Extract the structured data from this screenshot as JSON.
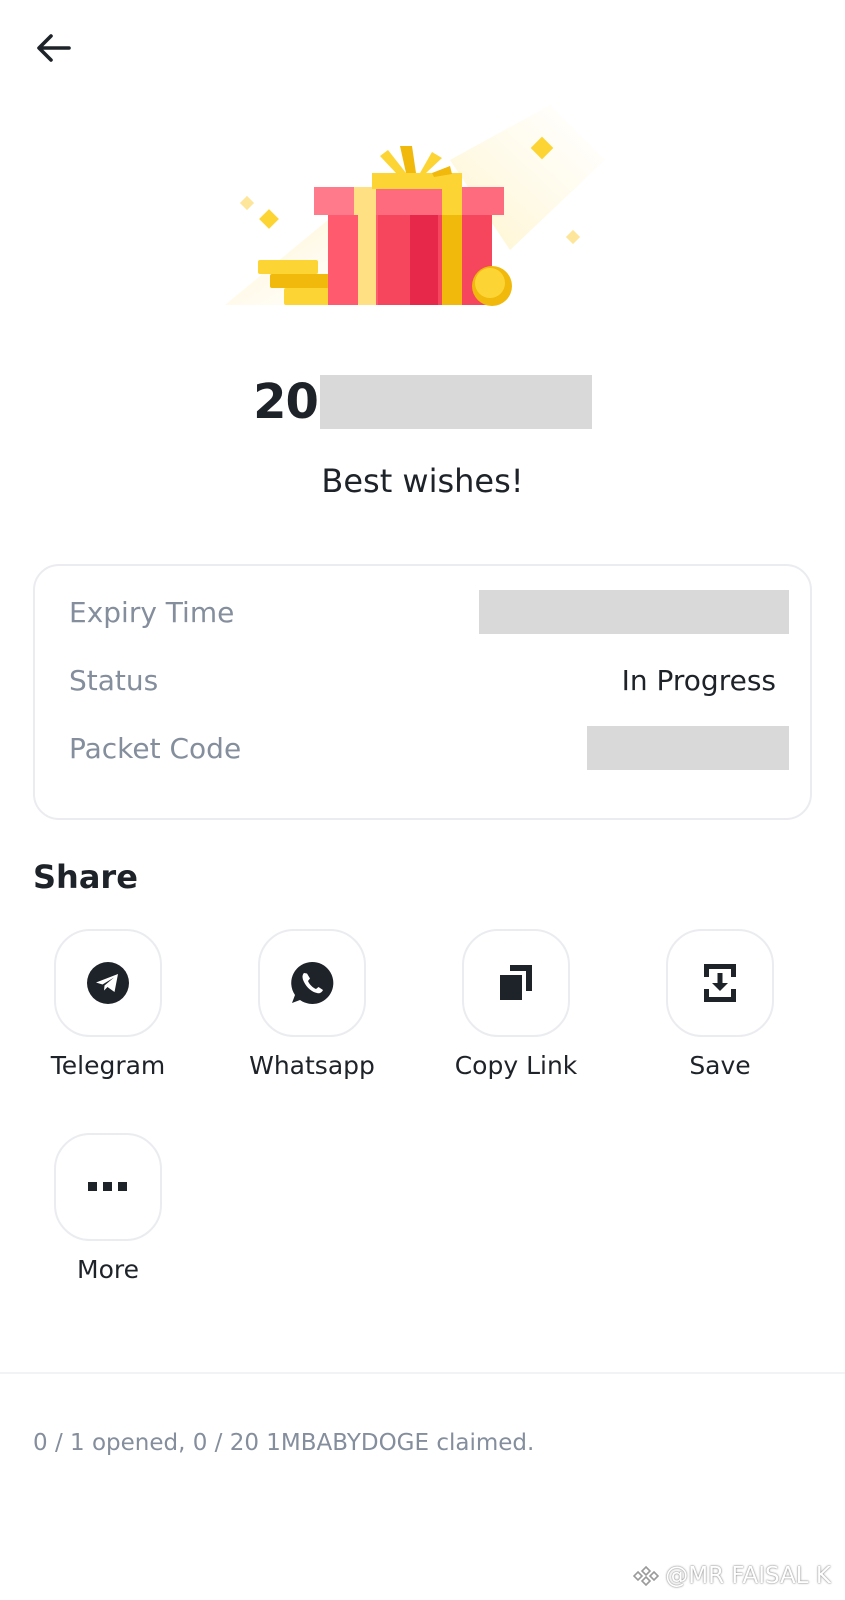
{
  "header": {
    "back_icon": "arrow-left-icon"
  },
  "packet": {
    "amount_prefix": "20",
    "greeting": "Best wishes!"
  },
  "details": {
    "rows": [
      {
        "label": "Expiry Time",
        "value": ""
      },
      {
        "label": "Status",
        "value": "In Progress"
      },
      {
        "label": "Packet Code",
        "value": ""
      }
    ]
  },
  "share": {
    "title": "Share",
    "options": [
      {
        "label": "Telegram",
        "icon": "telegram-icon"
      },
      {
        "label": "Whatsapp",
        "icon": "whatsapp-icon"
      },
      {
        "label": "Copy Link",
        "icon": "copy-icon"
      },
      {
        "label": "Save",
        "icon": "save-download-icon"
      },
      {
        "label": "More",
        "icon": "more-dots-icon"
      }
    ]
  },
  "footer": {
    "claim_summary": "0 / 1 opened, 0 / 20 1MBABYDOGE claimed."
  },
  "watermark": {
    "text": "@MR FAISAL K"
  },
  "colors": {
    "text_primary": "#1e2329",
    "text_secondary": "#848e9c",
    "border": "#eaecef",
    "gift_red": "#f6465d",
    "gift_gold": "#fcd535"
  }
}
